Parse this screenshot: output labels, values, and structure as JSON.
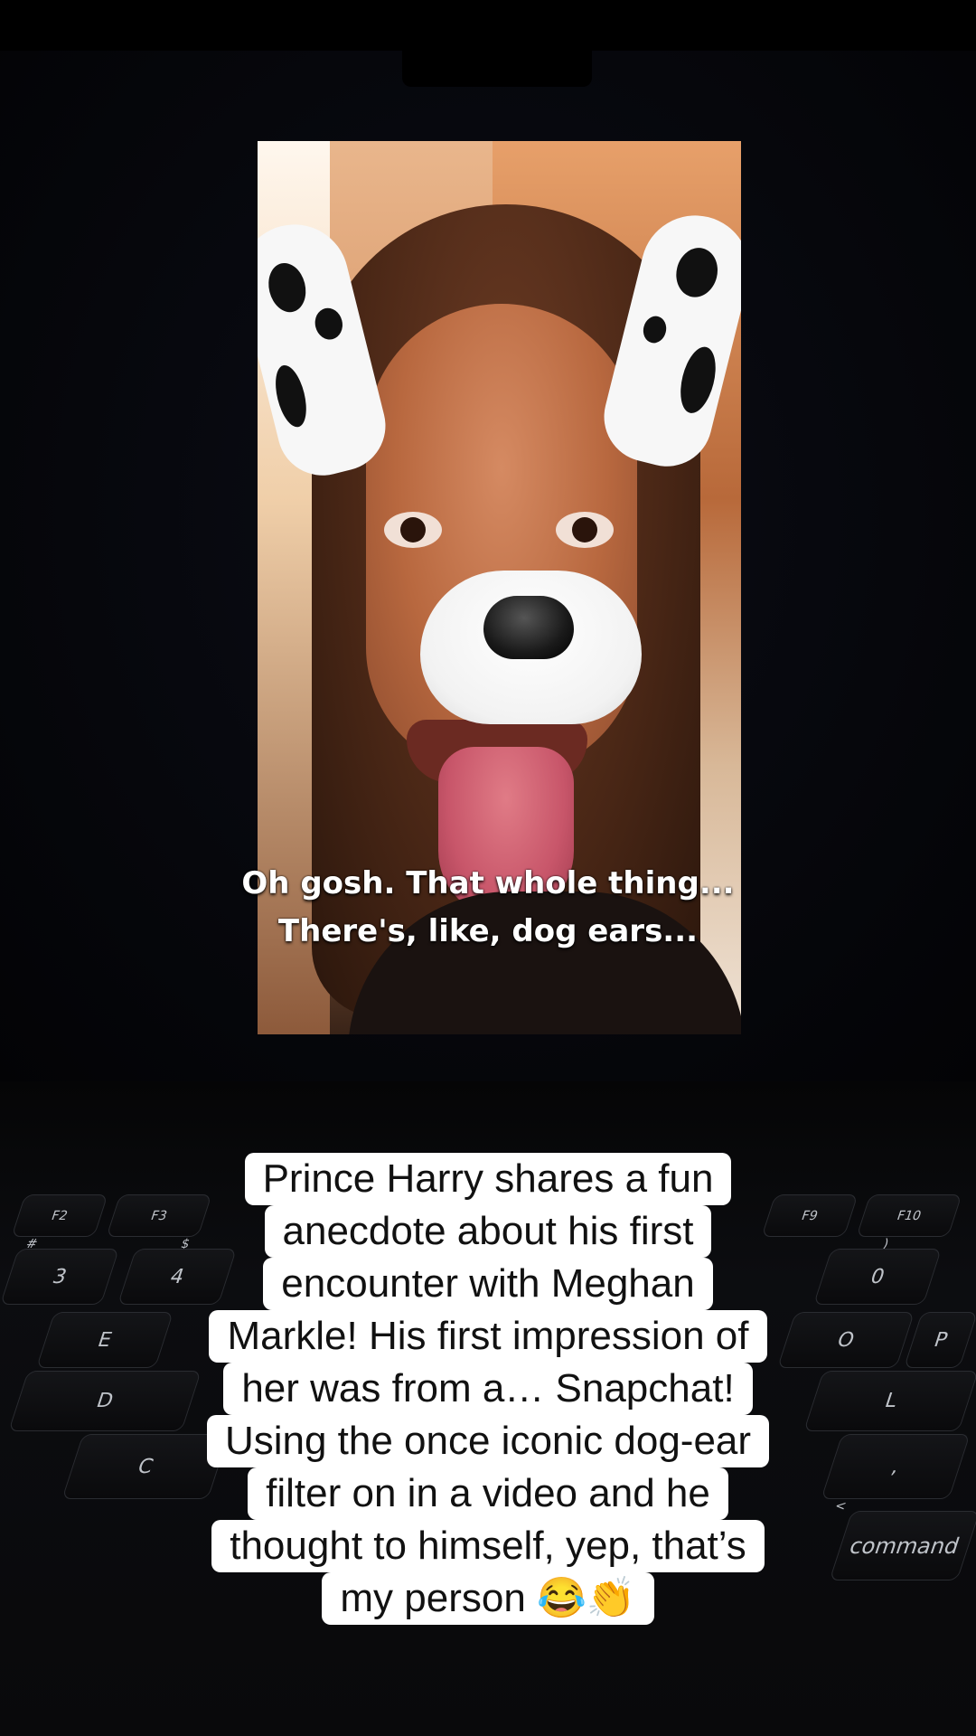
{
  "video": {
    "subtitle_line1": "Oh gosh. That whole thing...",
    "subtitle_line2": "There's, like, dog ears..."
  },
  "post_caption": {
    "lines": [
      "Prince Harry shares a fun",
      "anecdote about his first",
      "encounter with Meghan",
      "Markle! His first impression of",
      "her was from a… Snapchat!",
      "Using the once iconic dog-ear",
      "filter on in a video and he",
      "thought to himself, yep, that’s",
      "my person 😂👏"
    ]
  },
  "keyboard": {
    "keys": [
      "F2",
      "F3",
      "#",
      "3",
      "$",
      "4",
      "E",
      "D",
      "C",
      "F9",
      "F10",
      ")",
      "0",
      "O",
      "P",
      "L",
      "<",
      ",",
      "command"
    ]
  }
}
